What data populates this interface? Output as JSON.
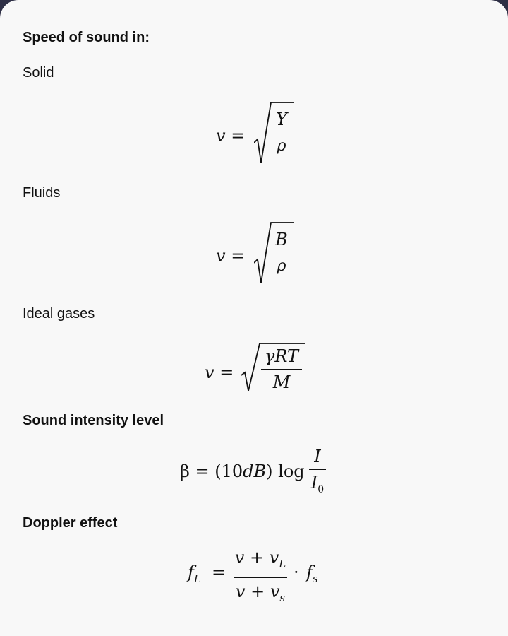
{
  "headings": {
    "speed": "Speed of sound in:",
    "solid": "Solid",
    "fluids": "Fluids",
    "gases": "Ideal gases",
    "intensity": "Sound intensity level",
    "doppler": "Doppler effect"
  },
  "formulas": {
    "solid": {
      "lhs": "v =",
      "num": "Y",
      "den": "ρ"
    },
    "fluids": {
      "lhs": "v =",
      "num": "B",
      "den": "ρ"
    },
    "gases": {
      "lhs": "v =",
      "num": "γRT",
      "den": "M"
    },
    "intensity": {
      "lhs": "β = (10",
      "mid_it": "dB",
      "close": ") log",
      "num": "I",
      "den_main": "I",
      "den_sub": "0"
    },
    "doppler": {
      "lhs_main": "f",
      "lhs_sub": "L",
      "eq": "=",
      "num_main": "v + v",
      "num_sub": "L",
      "den_main": "v + v",
      "den_sub": "s",
      "dot": "·",
      "rhs_main": "f",
      "rhs_sub": "s"
    }
  }
}
